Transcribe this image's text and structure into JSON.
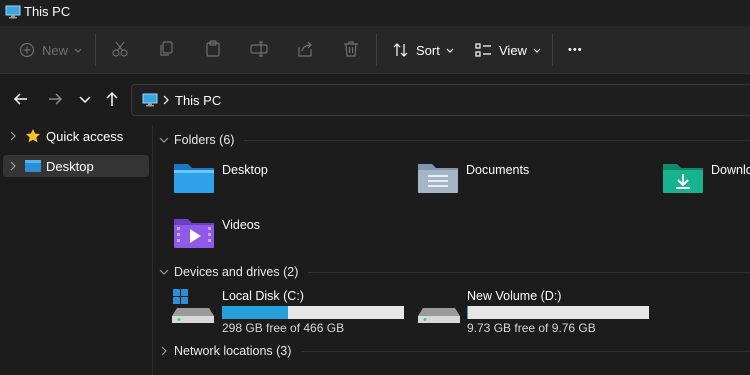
{
  "window": {
    "title": "This PC"
  },
  "toolbar": {
    "new_label": "New",
    "sort_label": "Sort",
    "view_label": "View",
    "more_label": "•••"
  },
  "address": {
    "crumb": "This PC"
  },
  "sidebar": {
    "items": [
      {
        "label": "Quick access"
      },
      {
        "label": "Desktop"
      }
    ]
  },
  "content": {
    "folders_header": "Folders (6)",
    "folders": [
      {
        "label": "Desktop",
        "icon": "desktop-folder-icon"
      },
      {
        "label": "Documents",
        "icon": "documents-folder-icon"
      },
      {
        "label": "Downlo",
        "icon": "downloads-folder-icon"
      },
      {
        "label": "Videos",
        "icon": "videos-folder-icon"
      }
    ],
    "drives_header": "Devices and drives (2)",
    "drives": [
      {
        "name": "Local Disk (C:)",
        "free": "298 GB free of 466 GB",
        "used_fraction": 0.36,
        "bar_color": "#26a0da"
      },
      {
        "name": "New Volume (D:)",
        "free": "9.73 GB free of 9.76 GB",
        "used_fraction": 0.003,
        "bar_color": "#26a0da"
      }
    ],
    "network_header": "Network locations (3)"
  },
  "colors": {
    "accent": "#26a0da",
    "background": "#1c1c1c"
  }
}
